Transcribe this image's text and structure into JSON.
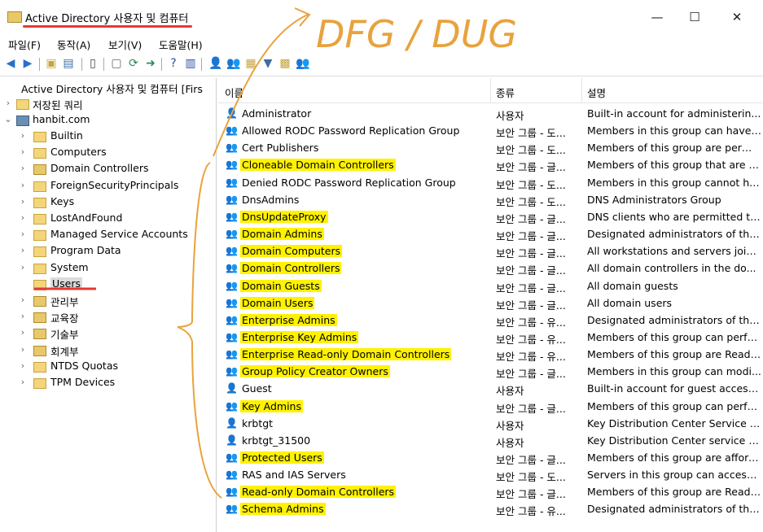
{
  "window": {
    "title": "Active Directory 사용자 및 컴퓨터",
    "minimize": "—",
    "maximize": "☐",
    "close": "✕"
  },
  "menu": [
    "파일(F)",
    "동작(A)",
    "보기(V)",
    "도움말(H)"
  ],
  "annotation_text": "DFG / DUG",
  "tree": {
    "root": "Active Directory 사용자 및 컴퓨터 [Firs",
    "saved_queries": "저장된 쿼리",
    "domain": "hanbit.com",
    "children": [
      "Builtin",
      "Computers",
      "Domain Controllers",
      "ForeignSecurityPrincipals",
      "Keys",
      "LostAndFound",
      "Managed Service Accounts",
      "Program Data",
      "System",
      "Users",
      "관리부",
      "교육장",
      "기술부",
      "회계부",
      "NTDS Quotas",
      "TPM Devices"
    ],
    "selected": "Users"
  },
  "list": {
    "headers": {
      "name": "이름",
      "type": "종류",
      "desc": "설명"
    },
    "rows": [
      {
        "name": "Administrator",
        "type": "사용자",
        "desc": "Built-in account for administerin...",
        "kind": "user",
        "hl": false
      },
      {
        "name": "Allowed RODC Password Replication Group",
        "type": "보안 그룹 - 도...",
        "desc": "Members in this group can have ...",
        "kind": "group",
        "hl": false
      },
      {
        "name": "Cert Publishers",
        "type": "보안 그룹 - 도...",
        "desc": "Members of this group are permi...",
        "kind": "group",
        "hl": false
      },
      {
        "name": "Cloneable Domain Controllers",
        "type": "보안 그룹 - 글...",
        "desc": "Members of this group that are d...",
        "kind": "group",
        "hl": true
      },
      {
        "name": "Denied RODC Password Replication Group",
        "type": "보안 그룹 - 도...",
        "desc": "Members in this group cannot ha...",
        "kind": "group",
        "hl": false
      },
      {
        "name": "DnsAdmins",
        "type": "보안 그룹 - 도...",
        "desc": "DNS Administrators Group",
        "kind": "group",
        "hl": false
      },
      {
        "name": "DnsUpdateProxy",
        "type": "보안 그룹 - 글...",
        "desc": "DNS clients who are permitted to...",
        "kind": "group",
        "hl": true
      },
      {
        "name": "Domain Admins",
        "type": "보안 그룹 - 글...",
        "desc": "Designated administrators of the ...",
        "kind": "group",
        "hl": true
      },
      {
        "name": "Domain Computers",
        "type": "보안 그룹 - 글...",
        "desc": "All workstations and servers joine...",
        "kind": "group",
        "hl": true
      },
      {
        "name": "Domain Controllers",
        "type": "보안 그룹 - 글...",
        "desc": "All domain controllers in the do...",
        "kind": "group",
        "hl": true
      },
      {
        "name": "Domain Guests",
        "type": "보안 그룹 - 글...",
        "desc": "All domain guests",
        "kind": "group",
        "hl": true
      },
      {
        "name": "Domain Users",
        "type": "보안 그룹 - 글...",
        "desc": "All domain users",
        "kind": "group",
        "hl": true
      },
      {
        "name": "Enterprise Admins",
        "type": "보안 그룹 - 유...",
        "desc": "Designated administrators of the ...",
        "kind": "group",
        "hl": true
      },
      {
        "name": "Enterprise Key Admins",
        "type": "보안 그룹 - 유...",
        "desc": "Members of this group can perfo...",
        "kind": "group",
        "hl": true
      },
      {
        "name": "Enterprise Read-only Domain Controllers",
        "type": "보안 그룹 - 유...",
        "desc": "Members of this group are Read-...",
        "kind": "group",
        "hl": true
      },
      {
        "name": "Group Policy Creator Owners",
        "type": "보안 그룹 - 글...",
        "desc": "Members in this group can modi...",
        "kind": "group",
        "hl": true
      },
      {
        "name": "Guest",
        "type": "사용자",
        "desc": "Built-in account for guest access ...",
        "kind": "user",
        "hl": false
      },
      {
        "name": "Key Admins",
        "type": "보안 그룹 - 글...",
        "desc": "Members of this group can perfo...",
        "kind": "group",
        "hl": true
      },
      {
        "name": "krbtgt",
        "type": "사용자",
        "desc": "Key Distribution Center Service A...",
        "kind": "user",
        "hl": false
      },
      {
        "name": "krbtgt_31500",
        "type": "사용자",
        "desc": "Key Distribution Center service ac...",
        "kind": "user",
        "hl": false
      },
      {
        "name": "Protected Users",
        "type": "보안 그룹 - 글...",
        "desc": "Members of this group are afford...",
        "kind": "group",
        "hl": true
      },
      {
        "name": "RAS and IAS Servers",
        "type": "보안 그룹 - 도...",
        "desc": "Servers in this group can access r...",
        "kind": "group",
        "hl": false
      },
      {
        "name": "Read-only Domain Controllers",
        "type": "보안 그룹 - 글...",
        "desc": "Members of this group are Read-...",
        "kind": "group",
        "hl": true
      },
      {
        "name": "Schema Admins",
        "type": "보안 그룹 - 유...",
        "desc": "Designated administrators of the ...",
        "kind": "group",
        "hl": true
      }
    ]
  },
  "icons": {
    "group": "👥",
    "user": "👤",
    "highlight_color": "#fff200",
    "annotation_color": "#e8a33d"
  }
}
